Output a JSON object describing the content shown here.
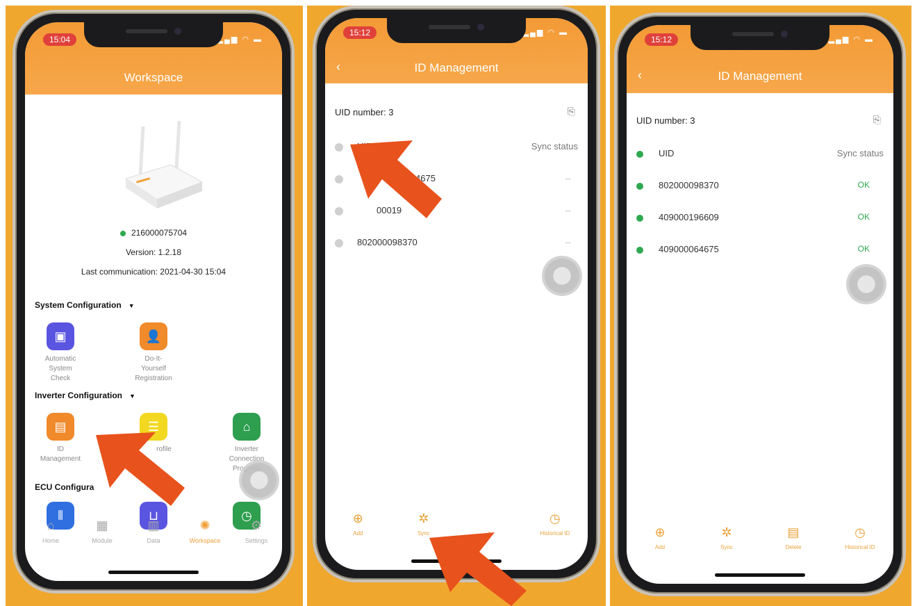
{
  "colors": {
    "background": "#f0a72e",
    "header": "#f39a36",
    "accent": "#f0a038",
    "status_ok": "#2fa84f",
    "arrow": "#e8521c"
  },
  "panel1": {
    "time": "15:04",
    "title": "Workspace",
    "ecu_id": "216000075704",
    "version": "Version: 1.2.18",
    "last_comm": "Last communication: 2021-04-30 15:04",
    "sections": {
      "system": "System Configuration",
      "inverter": "Inverter Configuration",
      "ecu": "ECU Configura"
    },
    "apps": {
      "auto_check": [
        "Automatic",
        "System",
        "Check"
      ],
      "diy": [
        "Do-It-",
        "Yourself",
        "Registration"
      ],
      "id_mgmt": [
        "ID",
        "Management"
      ],
      "profile": "rofile",
      "inv_conn": [
        "Inverter",
        "Connection",
        "Progress"
      ]
    },
    "tabs": [
      "Home",
      "Module",
      "Data",
      "Workspace",
      "Settings"
    ],
    "icons": {
      "auto_check": "toolbox-icon",
      "diy": "user-icon",
      "id_mgmt": "id-card-icon",
      "profile": "list-icon",
      "inv_conn": "connection-icon"
    }
  },
  "panel2": {
    "time": "15:12",
    "title": "ID Management",
    "uid_number": "UID number: 3",
    "header": {
      "uid": "UID",
      "sync": "Sync status"
    },
    "rows": [
      {
        "uid": "4675",
        "status": "--"
      },
      {
        "uid": "00019",
        "status": "--"
      },
      {
        "uid": "802000098370",
        "status": "--"
      }
    ],
    "bottom": {
      "add": "Add",
      "sync": "Sync",
      "delete": "e",
      "history": "Historical ID"
    }
  },
  "panel3": {
    "time": "15:12",
    "title": "ID Management",
    "uid_number": "UID number: 3",
    "header": {
      "uid": "UID",
      "sync": "Sync status"
    },
    "rows": [
      {
        "uid": "802000098370",
        "status": "OK"
      },
      {
        "uid": "409000196609",
        "status": "OK"
      },
      {
        "uid": "409000064675",
        "status": "OK"
      }
    ],
    "bottom": {
      "add": "Add",
      "sync": "Sync",
      "delete": "Delete",
      "history": "Historical ID"
    }
  }
}
